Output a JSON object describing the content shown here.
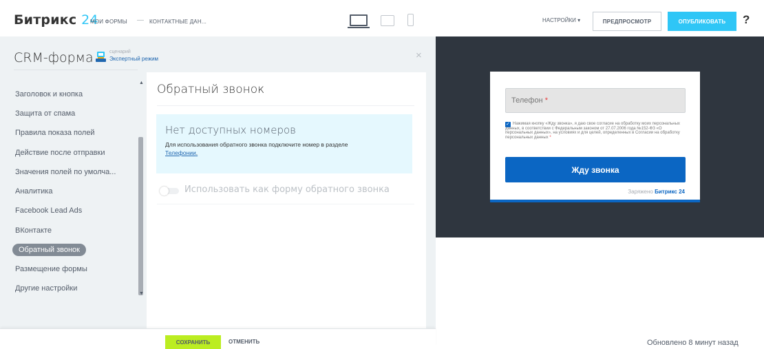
{
  "header": {
    "logo_text": "Битрикс",
    "logo_num": "24",
    "crumb1": "МОИ ФОРМЫ",
    "crumb_sep": "—",
    "crumb2": "КОНТАКТНЫЕ ДАН...",
    "settings": "НАСТРОЙКИ",
    "settings_caret": "▾",
    "preview": "ПРЕДПРОСМОТР",
    "publish": "ОПУБЛИКОВАТЬ",
    "help": "?",
    "accent_color": "#2fc6f6"
  },
  "panel": {
    "title": "CRM-форма",
    "mode_caption": "сценарий",
    "mode_link": "Экспертный режим",
    "close": "×"
  },
  "nav": {
    "items": [
      {
        "label": "Заголовок и кнопка"
      },
      {
        "label": "Защита от спама"
      },
      {
        "label": "Правила показа полей"
      },
      {
        "label": "Действие после отправки"
      },
      {
        "label": "Значения полей по умолча..."
      },
      {
        "label": "Аналитика"
      },
      {
        "label": "Facebook Lead Ads"
      },
      {
        "label": "ВКонтакте"
      },
      {
        "label": "Обратный звонок"
      },
      {
        "label": "Размещение формы"
      },
      {
        "label": "Другие настройки"
      }
    ],
    "active_index": 8
  },
  "content": {
    "title": "Обратный звонок",
    "info_title": "Нет доступных номеров",
    "info_text": "Для использования обратного звонка подключите номер в разделе",
    "info_link": "Телефонии",
    "info_link_suffix": ".",
    "toggle_label": "Использовать как форму обратного звонка"
  },
  "footer": {
    "save": "СОХРАНИТЬ",
    "cancel": "ОТМЕНИТЬ",
    "updated": "Обновлено 8 минут назад"
  },
  "preview": {
    "phone_label": "Телефон",
    "required_mark": "*",
    "consent": "Нажимая кнопку «Жду звонка», я даю свое согласие на обработку моих персональных данных, в соответствии с Федеральным законом от 27.07.2006 года №152-ФЗ «О персональных данных», на условиях и для целей, определенных в Согласии на обработку персональных данных",
    "button": "Жду звонка",
    "powered_by": "Заряжено",
    "powered_brand": "Битрикс",
    "powered_num": "24",
    "button_color": "#0b66c3"
  }
}
